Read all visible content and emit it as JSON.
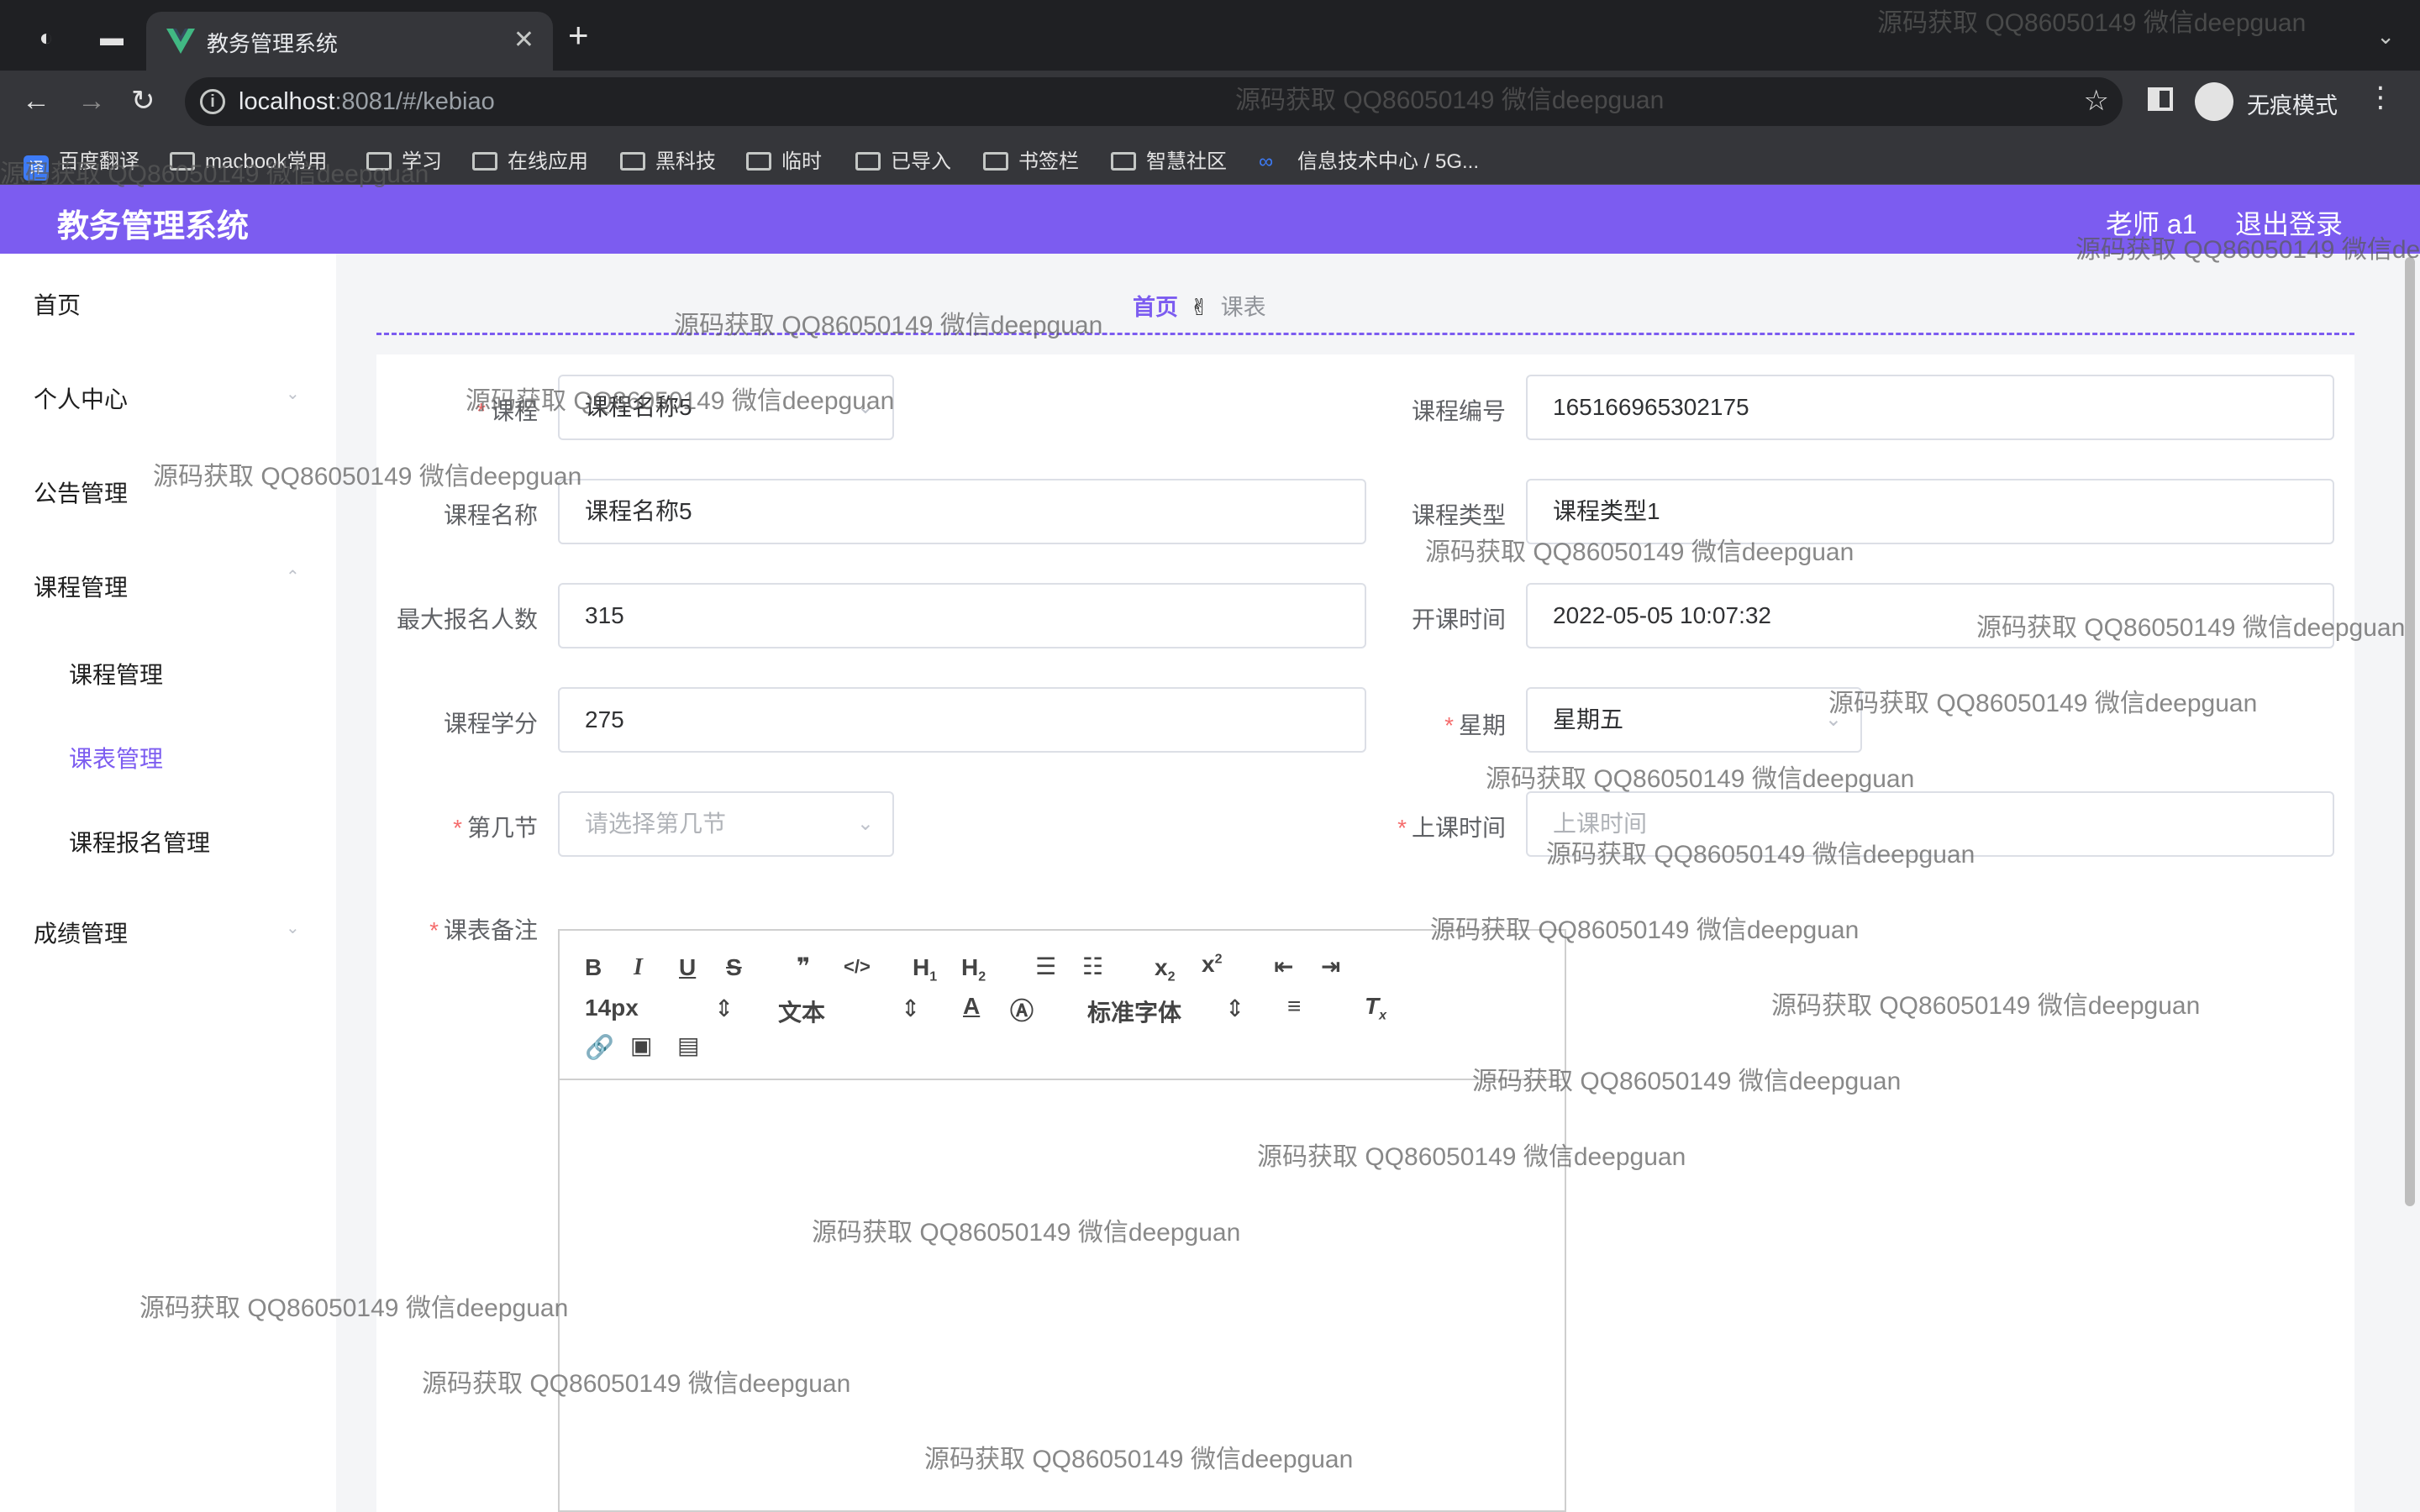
{
  "browser": {
    "tab_title": "教务管理系统",
    "url_host": "localhost",
    "url_rest": ":8081/#/kebiao",
    "incognito_label": "无痕模式",
    "bookmarks": [
      "百度翻译",
      "macbook常用",
      "学习",
      "在线应用",
      "黑科技",
      "临时",
      "已导入",
      "书签栏",
      "智慧社区",
      "信息技术中心 / 5G..."
    ]
  },
  "app": {
    "title": "教务管理系统",
    "user": "老师 a1",
    "logout": "退出登录",
    "accent_color": "#7c5cf0"
  },
  "sidebar": {
    "items": [
      "首页",
      "个人中心",
      "公告管理",
      "课程管理",
      "成绩管理"
    ],
    "sub_items": [
      "课程管理",
      "课表管理",
      "课程报名管理"
    ],
    "active": "课表管理"
  },
  "breadcrumb": {
    "home": "首页",
    "separator": "✌",
    "current": "课表"
  },
  "form": {
    "course_label": "课程",
    "course_value": "课程名称5",
    "course_no_label": "课程编号",
    "course_no_value": "165166965302175",
    "course_name_label": "课程名称",
    "course_name_value": "课程名称5",
    "course_type_label": "课程类型",
    "course_type_value": "课程类型1",
    "max_enroll_label": "最大报名人数",
    "max_enroll_value": "315",
    "start_time_label": "开课时间",
    "start_time_value": "2022-05-05 10:07:32",
    "credit_label": "课程学分",
    "credit_value": "275",
    "weekday_label": "星期",
    "weekday_value": "星期五",
    "section_label": "第几节",
    "section_placeholder": "请选择第几节",
    "class_time_label": "上课时间",
    "class_time_placeholder": "上课时间",
    "remark_label": "课表备注"
  },
  "editor": {
    "font_size": "14px",
    "header_select": "文本",
    "font_family": "标准字体"
  },
  "watermark": "源码获取 QQ86050149 微信deepguan"
}
